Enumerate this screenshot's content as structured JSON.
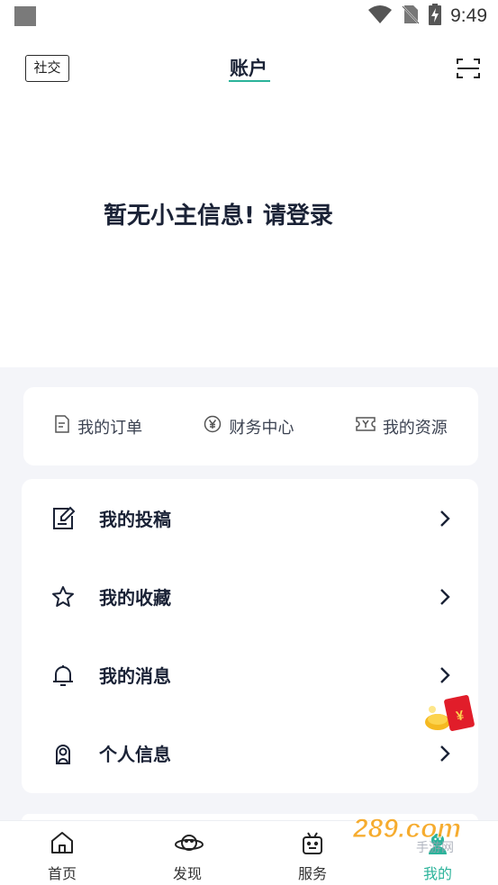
{
  "status_bar": {
    "time": "9:49"
  },
  "header": {
    "social_label": "社交",
    "title": "账户",
    "login_prompt": "暂无小主信息! 请登录"
  },
  "quick_links": [
    {
      "label": "我的订单",
      "icon": "document-icon"
    },
    {
      "label": "财务中心",
      "icon": "yuan-coin-icon"
    },
    {
      "label": "我的资源",
      "icon": "ticket-icon"
    }
  ],
  "menu": [
    {
      "label": "我的投稿",
      "icon": "edit-note-icon"
    },
    {
      "label": "我的收藏",
      "icon": "star-icon"
    },
    {
      "label": "我的消息",
      "icon": "bell-icon"
    },
    {
      "label": "个人信息",
      "icon": "user-icon"
    }
  ],
  "tabbar": [
    {
      "label": "首页",
      "icon": "home-icon"
    },
    {
      "label": "发现",
      "icon": "planet-icon"
    },
    {
      "label": "服务",
      "icon": "robot-icon"
    },
    {
      "label": "我的",
      "icon": "profile-icon",
      "active": true
    }
  ],
  "watermark": {
    "text": "289.com",
    "subtext": "手游网"
  },
  "colors": {
    "accent": "#2bb39a",
    "text_dark": "#1a2236",
    "background": "#f4f5f9"
  }
}
